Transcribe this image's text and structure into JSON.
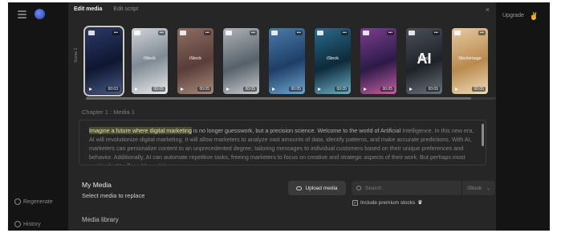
{
  "app": {
    "upgrade_label": "Upgrade"
  },
  "left_rail": {
    "regenerate_label": "Regenerate",
    "history_label": "History"
  },
  "modal": {
    "tabs": [
      {
        "label": "Edit media",
        "active": true
      },
      {
        "label": "Edit script",
        "active": false
      }
    ],
    "close_icon": "close-icon",
    "scene_label": "Scene 1",
    "thumbnails": [
      {
        "top": "",
        "mid": "",
        "big": "",
        "duration": "00:03",
        "bg": "linear-gradient(160deg,#2b3a66,#0e1630 55%,#485a84)"
      },
      {
        "top": "",
        "mid": "iStock",
        "big": "",
        "duration": "00:05",
        "bg": "linear-gradient(160deg,#cfd3d8,#7f8a94 50%,#e8ebee)"
      },
      {
        "top": "",
        "mid": "iStock",
        "big": "",
        "duration": "00:05",
        "bg": "linear-gradient(160deg,#8c6d62,#5a3d3a 55%,#a88b7c)"
      },
      {
        "top": "",
        "mid": "",
        "big": "",
        "duration": "00:05",
        "bg": "linear-gradient(160deg,#aeb3b6,#56616a 55%,#c8ccd0)"
      },
      {
        "top": "",
        "mid": "",
        "big": "",
        "duration": "00:05",
        "bg": "linear-gradient(160deg,#4a7ba8,#1f3e66 55%,#6fa6d0)"
      },
      {
        "top": "",
        "mid": "iStock",
        "big": "",
        "duration": "00:05",
        "bg": "linear-gradient(160deg,#2a6a8a,#0d2a3a 55%,#6fb0c8)"
      },
      {
        "top": "",
        "mid": "",
        "big": "",
        "duration": "00:05",
        "bg": "linear-gradient(160deg,#7a3e8e,#2c1a48 55%,#c45fa0)"
      },
      {
        "top": "",
        "mid": "iStock",
        "big": "AI",
        "duration": "00:05",
        "bg": "linear-gradient(160deg,#4a5058,#1e2228 55%,#6b737c)"
      },
      {
        "top": "",
        "mid": "Stockimage",
        "big": "",
        "duration": "00:05",
        "bg": "linear-gradient(160deg,#e6c9a0,#b98a4e 55%,#f0dcb8)"
      }
    ],
    "chapter_label": "Chapter 1 : Media 1",
    "script": {
      "highlight": "Imagine a future where digital marketing",
      "lead": " is no longer guesswork, but a precision science. Welcome to the world of Artificial",
      "rest": "Intelligence. In this new era, AI will revolutionize digital marketing. It will allow marketers to analyze vast amounts of data, identify patterns, and make accurate predictions. With AI, marketers can personalize content to an unprecedented degree, tailoring messages to individual customers based on their unique preferences and behavior. Additionally, AI can automate repetitive tasks, freeing marketers to focus on creative and strategic aspects of their work. But perhaps most excitingly, AI will enable real-time"
    },
    "my_media_label": "My Media",
    "select_media_label": "Select media to replace",
    "upload_label": "Upload media",
    "search_placeholder": "Search",
    "search_source": "iStock",
    "premium_label": "Include premium stocks",
    "premium_checked": true,
    "media_library_label": "Media library"
  }
}
